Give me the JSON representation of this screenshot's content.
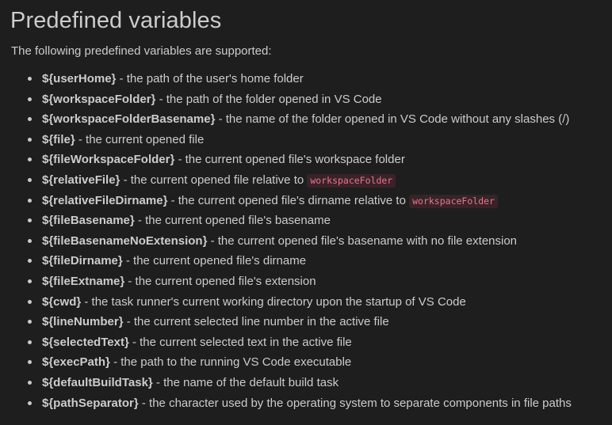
{
  "title": "Predefined variables",
  "intro": "The following predefined variables are supported:",
  "items": [
    {
      "name": "${userHome}",
      "desc": " - the path of the user's home folder",
      "code": ""
    },
    {
      "name": "${workspaceFolder}",
      "desc": " - the path of the folder opened in VS Code",
      "code": ""
    },
    {
      "name": "${workspaceFolderBasename}",
      "desc": " - the name of the folder opened in VS Code without any slashes (/)",
      "code": ""
    },
    {
      "name": "${file}",
      "desc": " - the current opened file",
      "code": ""
    },
    {
      "name": "${fileWorkspaceFolder}",
      "desc": " - the current opened file's workspace folder",
      "code": ""
    },
    {
      "name": "${relativeFile}",
      "desc": " - the current opened file relative to ",
      "code": "workspaceFolder"
    },
    {
      "name": "${relativeFileDirname}",
      "desc": " - the current opened file's dirname relative to ",
      "code": "workspaceFolder"
    },
    {
      "name": "${fileBasename}",
      "desc": " - the current opened file's basename",
      "code": ""
    },
    {
      "name": "${fileBasenameNoExtension}",
      "desc": " - the current opened file's basename with no file extension",
      "code": ""
    },
    {
      "name": "${fileDirname}",
      "desc": " - the current opened file's dirname",
      "code": ""
    },
    {
      "name": "${fileExtname}",
      "desc": " - the current opened file's extension",
      "code": ""
    },
    {
      "name": "${cwd}",
      "desc": " - the task runner's current working directory upon the startup of VS Code",
      "code": ""
    },
    {
      "name": "${lineNumber}",
      "desc": " - the current selected line number in the active file",
      "code": ""
    },
    {
      "name": "${selectedText}",
      "desc": " - the current selected text in the active file",
      "code": ""
    },
    {
      "name": "${execPath}",
      "desc": " - the path to the running VS Code executable",
      "code": ""
    },
    {
      "name": "${defaultBuildTask}",
      "desc": " - the name of the default build task",
      "code": ""
    },
    {
      "name": "${pathSeparator}",
      "desc": " - the character used by the operating system to separate components in file paths",
      "code": ""
    }
  ],
  "colors": {
    "background": "#1e1e1e",
    "text": "#cccccc",
    "code_text": "#e8768a",
    "code_background": "#3a2229"
  }
}
